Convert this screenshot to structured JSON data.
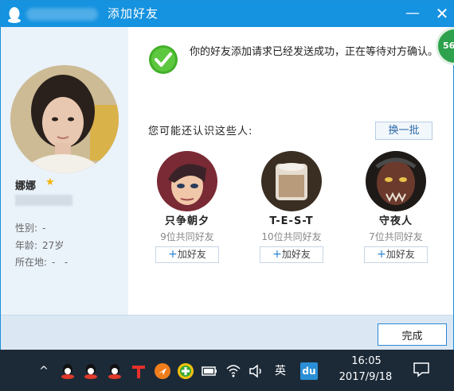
{
  "window": {
    "title": "添加好友",
    "minimize": "—",
    "close": "✕",
    "corner_badge": "56"
  },
  "profile": {
    "nickname": "娜娜",
    "gender_label": "性别:",
    "gender_value": "-",
    "age_label": "年龄:",
    "age_value": "27岁",
    "location_label": "所在地:",
    "location_value": "-   -"
  },
  "main": {
    "success_message": "你的好友添加请求已经发送成功，正在等待对方确认。",
    "may_know_label": "您可能还认识这些人:",
    "swap_button": "换一批"
  },
  "suggestions": [
    {
      "name": "只争朝夕",
      "mutual": "9位共同好友",
      "add_label": "加好友",
      "plus": "+"
    },
    {
      "name": "T-E-S-T",
      "mutual": "10位共同好友",
      "add_label": "加好友",
      "plus": "+"
    },
    {
      "name": "守夜人",
      "mutual": "7位共同好友",
      "add_label": "加好友",
      "plus": "+"
    }
  ],
  "footer": {
    "done_button": "完成"
  },
  "taskbar": {
    "ime": "英",
    "baidu": "du",
    "time": "16:05",
    "date": "2017/9/18"
  },
  "colors": {
    "titlebar": "#1592e0",
    "accent_blue": "#2b87d5",
    "success_green": "#43b02a",
    "taskbar": "#1c2a38"
  },
  "icons": [
    "qq-penguin-icon",
    "check-icon",
    "star-icon",
    "show-hidden-icons-icon",
    "qq-tray-icon",
    "tencent-icon",
    "airplane-icon",
    "plus-circle-icon",
    "battery-icon",
    "wifi-icon",
    "volume-icon",
    "notification-icon"
  ]
}
